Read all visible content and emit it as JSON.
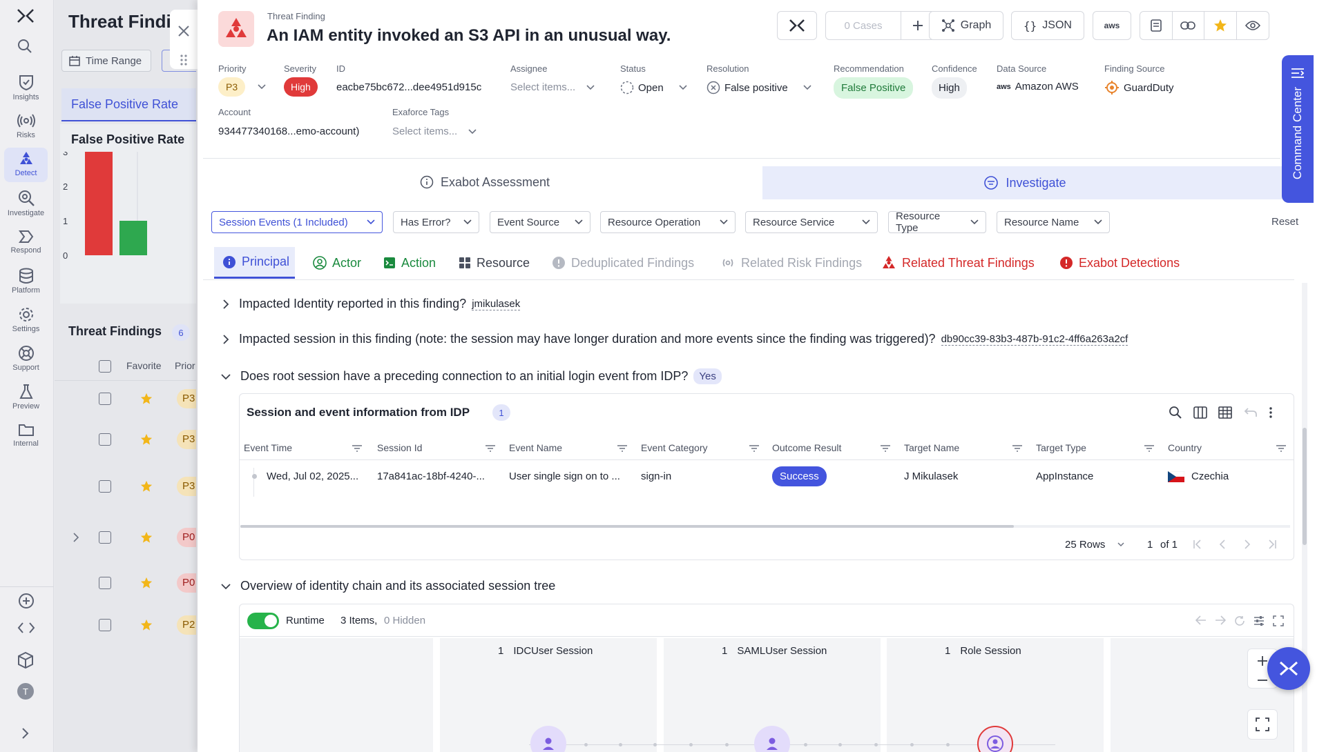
{
  "rail": {
    "items": [
      {
        "label": "Insights",
        "icon": "shield-check-icon"
      },
      {
        "label": "Risks",
        "icon": "radar-icon"
      },
      {
        "label": "Detect",
        "icon": "biohazard-icon"
      },
      {
        "label": "Investigate",
        "icon": "magnify-icon"
      },
      {
        "label": "Respond",
        "icon": "respond-icon"
      },
      {
        "label": "Platform",
        "icon": "database-icon"
      },
      {
        "label": "Settings",
        "icon": "gear-icon"
      },
      {
        "label": "Support",
        "icon": "lifebuoy-icon"
      },
      {
        "label": "Preview",
        "icon": "flask-icon"
      },
      {
        "label": "Internal",
        "icon": "folder-icon"
      }
    ],
    "avatar": "T"
  },
  "background": {
    "title": "Threat Findin",
    "time_range": "Time Range",
    "fp_tab": "False Positive Rate",
    "fp_chart_title": "False Positive Rate",
    "threat_findings": "Threat Findings",
    "threat_count": "6",
    "favorite_col": "Favorite",
    "priority_col": "Prior",
    "rows": [
      "P3",
      "P3",
      "P3",
      "P0",
      "P0",
      "P2"
    ]
  },
  "chart_data": {
    "type": "bar",
    "title": "False Positive Rate",
    "categories": [
      "",
      ""
    ],
    "values": [
      3,
      1
    ],
    "colors": [
      "#e03a3a",
      "#2ea84f"
    ],
    "ylim": [
      0,
      3
    ],
    "yticks": [
      "0",
      "1",
      "2",
      "3"
    ]
  },
  "header": {
    "kicker": "Threat Finding",
    "title": "An IAM entity invoked an S3 API in an unusual way.",
    "cases": "0 Cases",
    "graph": "Graph",
    "json": "JSON",
    "aws": "aws"
  },
  "fields": {
    "priority_label": "Priority",
    "priority": "P3",
    "severity_label": "Severity",
    "severity": "High",
    "id_label": "ID",
    "id": "eacbe75bc672...dee4951d915c",
    "assignee_label": "Assignee",
    "assignee_placeholder": "Select items...",
    "status_label": "Status",
    "status": "Open",
    "resolution_label": "Resolution",
    "resolution": "False positive",
    "recommendation_label": "Recommendation",
    "recommendation": "False Positive",
    "confidence_label": "Confidence",
    "confidence": "High",
    "data_source_label": "Data Source",
    "data_source": "Amazon AWS",
    "finding_source_label": "Finding Source",
    "finding_source": "GuardDuty",
    "account_label": "Account",
    "account": "934477340168...emo-account)",
    "tags_label": "Exaforce Tags",
    "tags_placeholder": "Select items..."
  },
  "command_center": "Command Center",
  "main_tabs": {
    "assessment": "Exabot Assessment",
    "investigate": "Investigate"
  },
  "filters": [
    "Session Events (1 Included)",
    "Has Error?",
    "Event Source",
    "Resource Operation",
    "Resource Service",
    "Resource Type",
    "Resource Name"
  ],
  "reset": "Reset",
  "subtabs": [
    "Principal",
    "Actor",
    "Action",
    "Resource",
    "Deduplicated Findings",
    "Related Risk Findings",
    "Related Threat Findings",
    "Exabot Detections"
  ],
  "questions": {
    "q1": "Impacted Identity reported in this finding?",
    "q1_val": "jmikulasek",
    "q2": "Impacted session in this finding (note: the session may have longer duration and more events since the finding was triggered)?",
    "q2_val": "db90cc39-83b3-487b-91c2-4ff6a263a2cf",
    "q3": "Does root session have a preceding connection to an initial login event from IDP?",
    "q3_val": "Yes",
    "q4": "Overview of identity chain and its associated session tree"
  },
  "idp_table": {
    "title": "Session and event information from IDP",
    "count": "1",
    "columns": [
      "Event Time",
      "Session Id",
      "Event Name",
      "Event Category",
      "Outcome Result",
      "Target Name",
      "Target Type",
      "Country"
    ],
    "row": {
      "event_time": "Wed, Jul 02, 2025...",
      "session_id": "17a841ac-18bf-4240-...",
      "event_name": "User single sign on to ...",
      "event_category": "sign-in",
      "outcome": "Success",
      "target_name": "J Mikulasek",
      "target_type": "AppInstance",
      "country": "Czechia"
    },
    "rows_per_page": "25 Rows",
    "page": "1",
    "of": "of 1"
  },
  "tree": {
    "runtime": "Runtime",
    "items": "3 Items,",
    "hidden": "0 Hidden",
    "columns": [
      {
        "count": "1",
        "label": "IDCUser Session"
      },
      {
        "count": "1",
        "label": "SAMLUser Session"
      },
      {
        "count": "1",
        "label": "Role Session"
      }
    ]
  }
}
